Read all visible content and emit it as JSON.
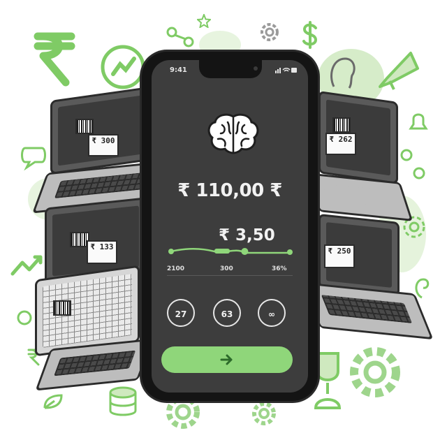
{
  "phone": {
    "status_time": "9:41",
    "currency_symbol": "₹",
    "main_amount": "₹ 110,00 ₹",
    "secondary_amount": "₹  3,50",
    "slider": {
      "level": 0.62
    },
    "scale_labels": [
      "2100",
      "300",
      "36%"
    ],
    "action_buttons": [
      "27",
      "63",
      "∞"
    ],
    "cta_icon": "arrow-right-icon",
    "brain_icon": "brain-icon"
  },
  "laptops": [
    {
      "price_tag": "₹ 300"
    },
    {
      "price_tag": "₹ 262"
    },
    {
      "price_tag": "₹ 133"
    },
    {
      "price_tag": "₹ 250"
    },
    {
      "price_tag": ""
    }
  ],
  "colors": {
    "accent_green": "#8fd67a",
    "doodle_green": "#7fcb65",
    "phone_body": "#141414",
    "phone_screen": "#3d3d3d"
  }
}
